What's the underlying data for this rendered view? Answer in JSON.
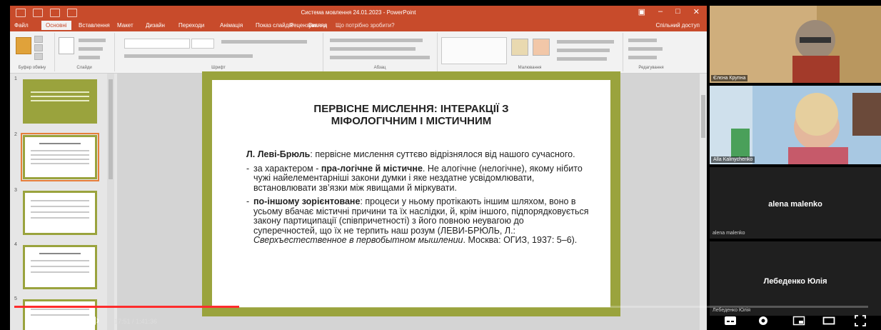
{
  "powerpoint": {
    "document_title": "Cистема мовлення 24.01.2023 - PowerPoint",
    "tabs": [
      "Файл",
      "Основні",
      "Вставлення",
      "Макет",
      "Дизайн",
      "Переходи",
      "Анімація",
      "Показ слайдів",
      "Рецензування",
      "Вигляд"
    ],
    "active_tab_index": 1,
    "tell_me": "Що потрібно зробити?",
    "share": "Спільний доступ",
    "ribbon_groups": [
      "Буфер обміну",
      "Слайди",
      "Шрифт",
      "Абзац",
      "Малювання",
      "Редагування"
    ],
    "thumbnail_numbers": [
      "1",
      "2",
      "3",
      "4",
      "5"
    ],
    "accent_color": "#c84b2b",
    "slide_frame_color": "#9aa33d"
  },
  "slide": {
    "title_line1": "ПЕРВІСНЕ МИСЛЕННЯ: ІНТЕРАКЦІЇ З",
    "title_line2": "МІФОЛОГІЧНИМ І МІСТИЧНИМ",
    "intro_author": "Л. Леві-Брюль",
    "intro_text": ": первісне мислення суттєво відрізнялося від нашого сучасного.",
    "bullet1_prefix": "за характером - ",
    "bullet1_bold": "пра-логічне й містичне",
    "bullet1_text": ". Не алогічне (нелогічне), якому нібито чужі найелементарніші закони думки і яке нездатне усвідомлювати, встановлювати зв’язки між явищами й міркувати.",
    "bullet2_bold": "по-іншому зорієнтоване",
    "bullet2_text": ": процеси у ньому протікають іншим шляхом, воно в усьому вбачає містичні причини та їх наслідки, й, крім іншого, підпорядковується закону партиципації (співпричетності) з його повною неувагою до суперечностей, що їх не терпить наш розум (ЛЕВИ-БРЮЛЬ, Л.: ",
    "bullet2_italic": "Сверхъестественное в первобытном мышлении",
    "bullet2_end": ". Москва: ОГИЗ, 1937: 5–6)."
  },
  "call": {
    "participants": [
      {
        "name": "Єлєна Крупна"
      },
      {
        "name": "Alla Kalinychenko"
      },
      {
        "name": "alena malenko",
        "small_label": "alena malenko"
      },
      {
        "name": "Лебеденко Юлія",
        "small_label": "Лебеденко Юлія"
      }
    ]
  },
  "player": {
    "time": "17:51 / 1:41:36",
    "progress_fraction": 0.263
  }
}
